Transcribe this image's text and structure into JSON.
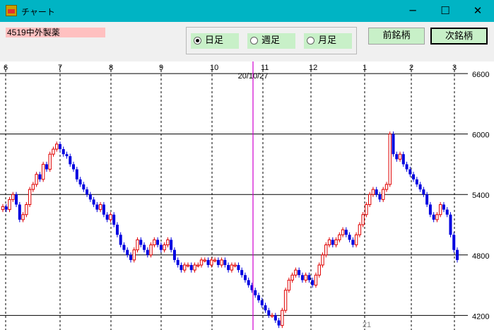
{
  "window": {
    "title": "チャート",
    "minimize": "─",
    "maximize": "☐",
    "close": "✕"
  },
  "toolbar": {
    "ticker": "4519中外製薬",
    "radios": [
      {
        "label": "日足",
        "selected": true
      },
      {
        "label": "週足",
        "selected": false
      },
      {
        "label": "月足",
        "selected": false
      }
    ],
    "prev_label": "前銘柄",
    "next_label": "次銘柄"
  },
  "chart_data": {
    "type": "candlestick",
    "month_labels": [
      "6",
      "7",
      "8",
      "9",
      "10",
      "11",
      "12",
      "1",
      "2",
      "3"
    ],
    "y_ticks": [
      6600,
      6000,
      5400,
      4800,
      4200
    ],
    "ylim": [
      4055,
      6720
    ],
    "cursor_date": "20/10/27",
    "cursor_value": "21",
    "up_color": "#e00000",
    "down_color": "#0000e0",
    "cursor_color": "#d000d0",
    "close_values": [
      5280,
      5250,
      5350,
      5400,
      5300,
      5150,
      5200,
      5300,
      5450,
      5500,
      5600,
      5550,
      5700,
      5650,
      5800,
      5850,
      5900,
      5850,
      5800,
      5780,
      5700,
      5650,
      5550,
      5500,
      5450,
      5400,
      5350,
      5300,
      5250,
      5300,
      5200,
      5150,
      5200,
      5100,
      5000,
      4900,
      4850,
      4800,
      4750,
      4850,
      4950,
      4900,
      4850,
      4800,
      4900,
      4950,
      4900,
      4850,
      4900,
      4950,
      4850,
      4750,
      4700,
      4650,
      4700,
      4700,
      4650,
      4700,
      4700,
      4750,
      4750,
      4700,
      4750,
      4750,
      4700,
      4750,
      4700,
      4650,
      4700,
      4700,
      4650,
      4600,
      4550,
      4500,
      4450,
      4400,
      4350,
      4300,
      4250,
      4200,
      4200,
      4150,
      4100,
      4250,
      4450,
      4550,
      4600,
      4650,
      4600,
      4550,
      4600,
      4550,
      4500,
      4600,
      4700,
      4800,
      4900,
      4950,
      4900,
      4950,
      5000,
      5050,
      5000,
      4950,
      4900,
      5000,
      5100,
      5200,
      5300,
      5400,
      5450,
      5400,
      5350,
      5450,
      5500,
      6000,
      5800,
      5750,
      5800,
      5700,
      5650,
      5600,
      5550,
      5500,
      5450,
      5400,
      5300,
      5200,
      5150,
      5200,
      5300,
      5250,
      5200,
      5000,
      4850,
      4750
    ]
  }
}
